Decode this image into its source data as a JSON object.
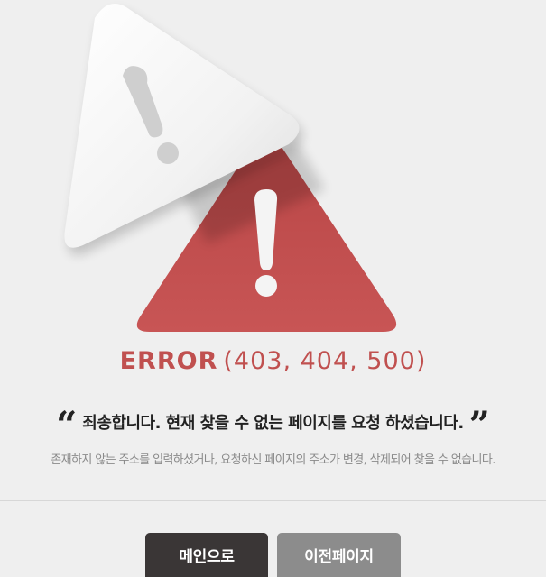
{
  "error": {
    "label": "ERROR",
    "codes": "(403, 404, 500)"
  },
  "headline": {
    "open_quote": "“",
    "text": "죄송합니다. 현재 찾을 수 없는 페이지를 요청 하셨습니다.",
    "close_quote": "”"
  },
  "description": "존재하지 않는 주소를 입력하셨거나, 요청하신 페이지의 주소가 변경, 삭제되어 찾을 수 없습니다.",
  "buttons": {
    "main_label": "메인으로",
    "prev_label": "이전페이지"
  },
  "colors": {
    "background": "#efefef",
    "accent_red": "#c0504f",
    "main_button": "#3a3636",
    "prev_button": "#8c8c8c"
  },
  "icons": {
    "front": "warning-triangle-icon",
    "back": "warning-triangle-icon"
  }
}
